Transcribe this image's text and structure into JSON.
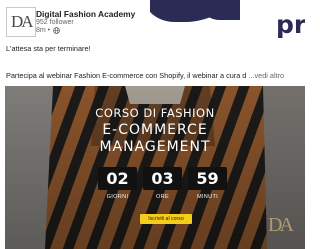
{
  "post": {
    "company_name": "Digital Fashion Academy",
    "followers": "952 follower",
    "time": "8m •",
    "line1": "L'attesa sta per terminare!",
    "line2": "Partecipa al webinar Fashion E-commerce con Shopify, il webinar a cura d",
    "more": " ...vedi altro",
    "logo_text": "DA"
  },
  "slide": {
    "title_line1": "CORSO DI FASHION",
    "title_line2": "E-COMMERCE",
    "title_line3": "MANAGEMENT",
    "countdown": [
      {
        "value": "02",
        "label": "GIORNI"
      },
      {
        "value": "03",
        "label": "ORE"
      },
      {
        "value": "59",
        "label": "MINUTI"
      }
    ],
    "cta_label": "Iscriviti al corso",
    "watermark": "DA"
  },
  "colors": {
    "accent_yellow": "#f4cc1b",
    "stripe_orange": "#b8703a",
    "stripe_dark": "#262422"
  },
  "icons": [
    "globe-icon"
  ]
}
